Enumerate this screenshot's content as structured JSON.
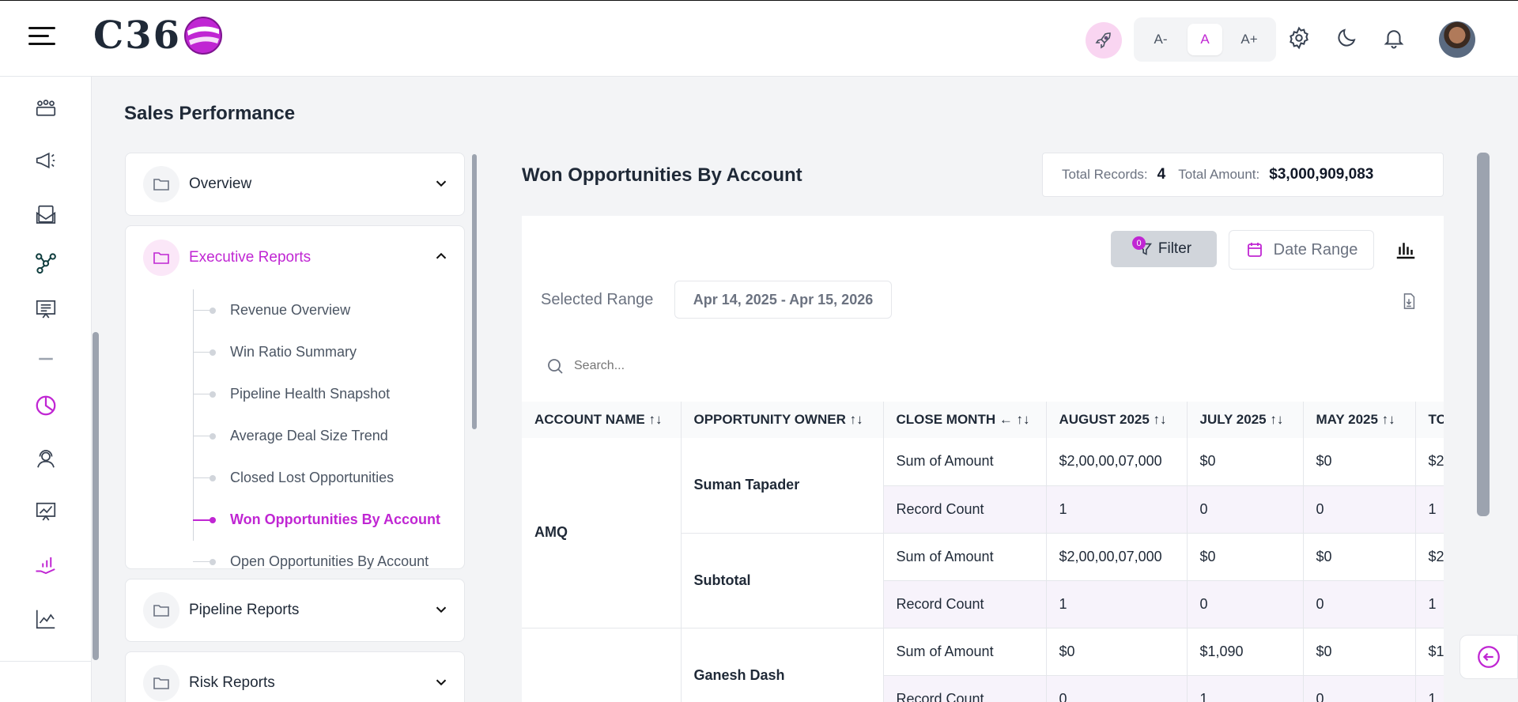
{
  "header": {
    "logo_text": "C36",
    "font_small": "A-",
    "font_normal": "A",
    "font_large": "A+"
  },
  "page": {
    "title": "Sales Performance"
  },
  "nav": {
    "overview": "Overview",
    "executive": "Executive Reports",
    "executive_items": [
      "Revenue Overview",
      "Win Ratio Summary",
      "Pipeline Health Snapshot",
      "Average Deal Size Trend",
      "Closed Lost Opportunities",
      "Won Opportunities By Account",
      "Open Opportunities By Account"
    ],
    "pipeline": "Pipeline Reports",
    "risk": "Risk Reports"
  },
  "report": {
    "title": "Won Opportunities By Account",
    "total_records_label": "Total Records:",
    "total_records": "4",
    "total_amount_label": "Total Amount:",
    "total_amount": "$3,000,909,083",
    "filter_label": "Filter",
    "filter_count": "0",
    "date_range_label": "Date Range",
    "selected_range_label": "Selected Range",
    "selected_range": "Apr 14, 2025 - Apr 15, 2026",
    "search_placeholder": "Search..."
  },
  "table": {
    "headers": [
      "ACCOUNT NAME ↑↓",
      "OPPORTUNITY OWNER ↑↓",
      "CLOSE MONTH ← ↑↓",
      "AUGUST 2025 ↑↓",
      "JULY 2025 ↑↓",
      "MAY 2025 ↑↓",
      "TO"
    ],
    "account_1": "AMQ",
    "owner_1": "Suman Tapader",
    "owner_2": "Subtotal",
    "owner_3": "Ganesh Dash",
    "rows": [
      [
        "Sum of Amount",
        "$2,00,00,07,000",
        "$0",
        "$0",
        "$2"
      ],
      [
        "Record Count",
        "1",
        "0",
        "0",
        "1"
      ],
      [
        "Sum of Amount",
        "$2,00,00,07,000",
        "$0",
        "$0",
        "$2"
      ],
      [
        "Record Count",
        "1",
        "0",
        "0",
        "1"
      ],
      [
        "Sum of Amount",
        "$0",
        "$1,090",
        "$0",
        "$1,"
      ],
      [
        "Record Count",
        "0",
        "1",
        "0",
        "1"
      ]
    ]
  }
}
